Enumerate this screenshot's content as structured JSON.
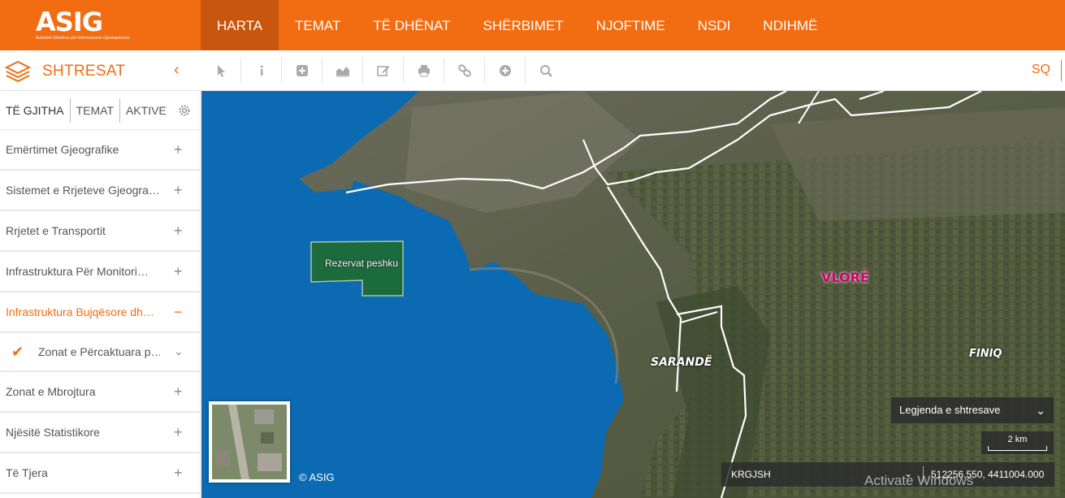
{
  "header": {
    "logo_text": "ASIG",
    "logo_tagline": "Autoriteti Shtetëror për Informacionin Gjeohapësinor",
    "nav": [
      {
        "label": "HARTA",
        "active": true
      },
      {
        "label": "TEMAT"
      },
      {
        "label": "TË DHËNAT"
      },
      {
        "label": "SHËRBIMET"
      },
      {
        "label": "NJOFTIME"
      },
      {
        "label": "NSDI"
      },
      {
        "label": "NDIHMË"
      }
    ],
    "accent": "#f26d12"
  },
  "toolbar": {
    "panel_title": "SHTRESAT",
    "collapse_glyph": "‹",
    "tools": [
      "cursor-icon",
      "info-icon",
      "plus-square-icon",
      "chart-area-icon",
      "edit-icon",
      "print-icon",
      "link-icon",
      "plus-circle-icon",
      "search-icon"
    ],
    "language": "SQ"
  },
  "sidebar": {
    "tabs": [
      {
        "label": "TË GJITHA",
        "active": true
      },
      {
        "label": "TEMAT"
      },
      {
        "label": "AKTIVE"
      }
    ],
    "items": [
      {
        "label": "Emërtimet Gjeografike",
        "sign": "+"
      },
      {
        "label": "Sistemet e Rrjeteve Gjeogra…",
        "sign": "+"
      },
      {
        "label": "Rrjetet e Transportit",
        "sign": "+"
      },
      {
        "label": "Infrastruktura Për Monitori…",
        "sign": "+"
      },
      {
        "label": "Infrastruktura Bujqësore dh…",
        "sign": "−",
        "open": true
      },
      {
        "label": "Zonat e Përcaktuara p…",
        "sub": true,
        "checked": true,
        "sign": "⌄"
      },
      {
        "label": "Zonat e Mbrojtura",
        "sign": "+"
      },
      {
        "label": "Njësitë Statistikore",
        "sign": "+"
      },
      {
        "label": "Të Tjera",
        "sign": "+"
      }
    ]
  },
  "map": {
    "labels": {
      "reserve": "Rezervat peshku",
      "vlore": "VLORË",
      "sarande": "SARANDË",
      "finiq": "FINIQ"
    },
    "copyright": "© ASIG",
    "legend_button": "Legjenda e shtresave",
    "scale": "2 km",
    "crs": "KRGJSH",
    "coordinates": "512256.550, 4411004.000",
    "watermark": "Activate Windows"
  }
}
